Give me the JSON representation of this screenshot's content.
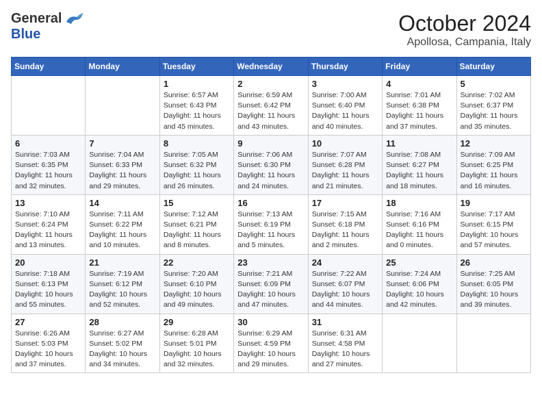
{
  "logo": {
    "general": "General",
    "blue": "Blue"
  },
  "title": "October 2024",
  "location": "Apollosa, Campania, Italy",
  "headers": [
    "Sunday",
    "Monday",
    "Tuesday",
    "Wednesday",
    "Thursday",
    "Friday",
    "Saturday"
  ],
  "weeks": [
    [
      {
        "day": "",
        "sunrise": "",
        "sunset": "",
        "daylight": ""
      },
      {
        "day": "",
        "sunrise": "",
        "sunset": "",
        "daylight": ""
      },
      {
        "day": "1",
        "sunrise": "Sunrise: 6:57 AM",
        "sunset": "Sunset: 6:43 PM",
        "daylight": "Daylight: 11 hours and 45 minutes."
      },
      {
        "day": "2",
        "sunrise": "Sunrise: 6:59 AM",
        "sunset": "Sunset: 6:42 PM",
        "daylight": "Daylight: 11 hours and 43 minutes."
      },
      {
        "day": "3",
        "sunrise": "Sunrise: 7:00 AM",
        "sunset": "Sunset: 6:40 PM",
        "daylight": "Daylight: 11 hours and 40 minutes."
      },
      {
        "day": "4",
        "sunrise": "Sunrise: 7:01 AM",
        "sunset": "Sunset: 6:38 PM",
        "daylight": "Daylight: 11 hours and 37 minutes."
      },
      {
        "day": "5",
        "sunrise": "Sunrise: 7:02 AM",
        "sunset": "Sunset: 6:37 PM",
        "daylight": "Daylight: 11 hours and 35 minutes."
      }
    ],
    [
      {
        "day": "6",
        "sunrise": "Sunrise: 7:03 AM",
        "sunset": "Sunset: 6:35 PM",
        "daylight": "Daylight: 11 hours and 32 minutes."
      },
      {
        "day": "7",
        "sunrise": "Sunrise: 7:04 AM",
        "sunset": "Sunset: 6:33 PM",
        "daylight": "Daylight: 11 hours and 29 minutes."
      },
      {
        "day": "8",
        "sunrise": "Sunrise: 7:05 AM",
        "sunset": "Sunset: 6:32 PM",
        "daylight": "Daylight: 11 hours and 26 minutes."
      },
      {
        "day": "9",
        "sunrise": "Sunrise: 7:06 AM",
        "sunset": "Sunset: 6:30 PM",
        "daylight": "Daylight: 11 hours and 24 minutes."
      },
      {
        "day": "10",
        "sunrise": "Sunrise: 7:07 AM",
        "sunset": "Sunset: 6:28 PM",
        "daylight": "Daylight: 11 hours and 21 minutes."
      },
      {
        "day": "11",
        "sunrise": "Sunrise: 7:08 AM",
        "sunset": "Sunset: 6:27 PM",
        "daylight": "Daylight: 11 hours and 18 minutes."
      },
      {
        "day": "12",
        "sunrise": "Sunrise: 7:09 AM",
        "sunset": "Sunset: 6:25 PM",
        "daylight": "Daylight: 11 hours and 16 minutes."
      }
    ],
    [
      {
        "day": "13",
        "sunrise": "Sunrise: 7:10 AM",
        "sunset": "Sunset: 6:24 PM",
        "daylight": "Daylight: 11 hours and 13 minutes."
      },
      {
        "day": "14",
        "sunrise": "Sunrise: 7:11 AM",
        "sunset": "Sunset: 6:22 PM",
        "daylight": "Daylight: 11 hours and 10 minutes."
      },
      {
        "day": "15",
        "sunrise": "Sunrise: 7:12 AM",
        "sunset": "Sunset: 6:21 PM",
        "daylight": "Daylight: 11 hours and 8 minutes."
      },
      {
        "day": "16",
        "sunrise": "Sunrise: 7:13 AM",
        "sunset": "Sunset: 6:19 PM",
        "daylight": "Daylight: 11 hours and 5 minutes."
      },
      {
        "day": "17",
        "sunrise": "Sunrise: 7:15 AM",
        "sunset": "Sunset: 6:18 PM",
        "daylight": "Daylight: 11 hours and 2 minutes."
      },
      {
        "day": "18",
        "sunrise": "Sunrise: 7:16 AM",
        "sunset": "Sunset: 6:16 PM",
        "daylight": "Daylight: 11 hours and 0 minutes."
      },
      {
        "day": "19",
        "sunrise": "Sunrise: 7:17 AM",
        "sunset": "Sunset: 6:15 PM",
        "daylight": "Daylight: 10 hours and 57 minutes."
      }
    ],
    [
      {
        "day": "20",
        "sunrise": "Sunrise: 7:18 AM",
        "sunset": "Sunset: 6:13 PM",
        "daylight": "Daylight: 10 hours and 55 minutes."
      },
      {
        "day": "21",
        "sunrise": "Sunrise: 7:19 AM",
        "sunset": "Sunset: 6:12 PM",
        "daylight": "Daylight: 10 hours and 52 minutes."
      },
      {
        "day": "22",
        "sunrise": "Sunrise: 7:20 AM",
        "sunset": "Sunset: 6:10 PM",
        "daylight": "Daylight: 10 hours and 49 minutes."
      },
      {
        "day": "23",
        "sunrise": "Sunrise: 7:21 AM",
        "sunset": "Sunset: 6:09 PM",
        "daylight": "Daylight: 10 hours and 47 minutes."
      },
      {
        "day": "24",
        "sunrise": "Sunrise: 7:22 AM",
        "sunset": "Sunset: 6:07 PM",
        "daylight": "Daylight: 10 hours and 44 minutes."
      },
      {
        "day": "25",
        "sunrise": "Sunrise: 7:24 AM",
        "sunset": "Sunset: 6:06 PM",
        "daylight": "Daylight: 10 hours and 42 minutes."
      },
      {
        "day": "26",
        "sunrise": "Sunrise: 7:25 AM",
        "sunset": "Sunset: 6:05 PM",
        "daylight": "Daylight: 10 hours and 39 minutes."
      }
    ],
    [
      {
        "day": "27",
        "sunrise": "Sunrise: 6:26 AM",
        "sunset": "Sunset: 5:03 PM",
        "daylight": "Daylight: 10 hours and 37 minutes."
      },
      {
        "day": "28",
        "sunrise": "Sunrise: 6:27 AM",
        "sunset": "Sunset: 5:02 PM",
        "daylight": "Daylight: 10 hours and 34 minutes."
      },
      {
        "day": "29",
        "sunrise": "Sunrise: 6:28 AM",
        "sunset": "Sunset: 5:01 PM",
        "daylight": "Daylight: 10 hours and 32 minutes."
      },
      {
        "day": "30",
        "sunrise": "Sunrise: 6:29 AM",
        "sunset": "Sunset: 4:59 PM",
        "daylight": "Daylight: 10 hours and 29 minutes."
      },
      {
        "day": "31",
        "sunrise": "Sunrise: 6:31 AM",
        "sunset": "Sunset: 4:58 PM",
        "daylight": "Daylight: 10 hours and 27 minutes."
      },
      {
        "day": "",
        "sunrise": "",
        "sunset": "",
        "daylight": ""
      },
      {
        "day": "",
        "sunrise": "",
        "sunset": "",
        "daylight": ""
      }
    ]
  ]
}
